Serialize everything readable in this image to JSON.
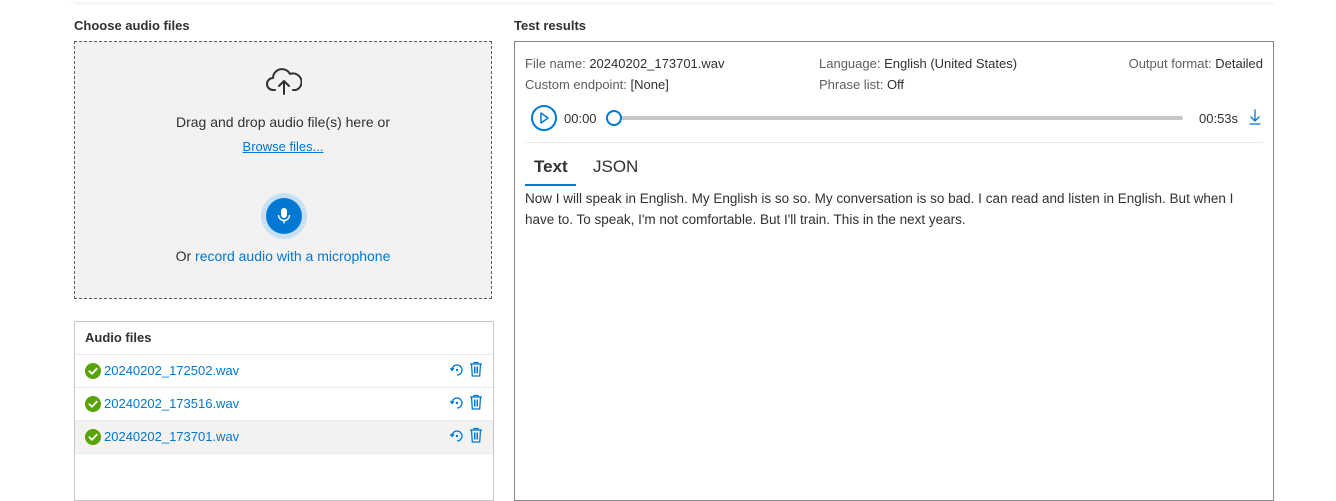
{
  "left": {
    "title": "Choose audio files",
    "dropzone": {
      "drag_text": "Drag and drop audio file(s) here or",
      "browse_label": "Browse files...",
      "record_prefix": "Or",
      "record_link": "record audio with a microphone"
    },
    "files": {
      "header": "Audio files",
      "items": [
        {
          "name": "20240202_172502.wav",
          "status": "success"
        },
        {
          "name": "20240202_173516.wav",
          "status": "success"
        },
        {
          "name": "20240202_173701.wav",
          "status": "success",
          "selected": true
        }
      ]
    }
  },
  "results": {
    "title": "Test results",
    "file_name_label": "File name:",
    "file_name": "20240202_173701.wav",
    "language_label": "Language:",
    "language": "English (United States)",
    "output_format_label": "Output format:",
    "output_format": "Detailed",
    "endpoint_label": "Custom endpoint:",
    "endpoint": "[None]",
    "phrase_list_label": "Phrase list:",
    "phrase_list": "Off",
    "player": {
      "current": "00:00",
      "duration": "00:53s",
      "progress": 0
    },
    "tabs": [
      {
        "label": "Text",
        "active": true
      },
      {
        "label": "JSON",
        "active": false
      }
    ],
    "transcript": "Now I will speak in English. My English is so so. My conversation is so bad. I can read and listen in English. But when I have to. To speak, I'm not comfortable. But I'll train. This in the next years."
  },
  "colors": {
    "accent": "#0078d4",
    "success": "#57a300",
    "dropzone_bg": "#f3f2f1"
  },
  "icons": [
    "cloud-upload-icon",
    "microphone-icon",
    "checkmark-circle-icon",
    "refresh-icon",
    "delete-icon",
    "play-icon",
    "download-icon"
  ]
}
